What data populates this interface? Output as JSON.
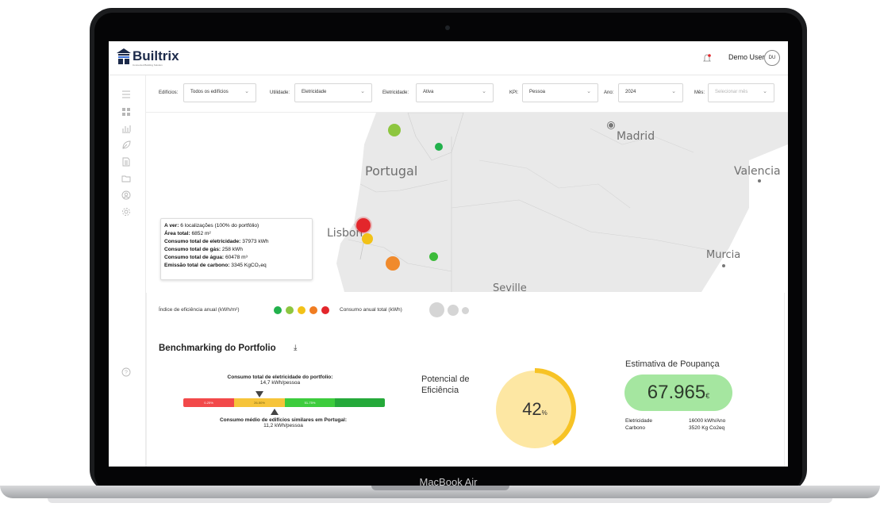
{
  "device": {
    "label": "MacBook Air"
  },
  "header": {
    "logo_text": "Builtrix",
    "logo_subtitle": "Connected Building Solution",
    "user_name": "Demo User",
    "user_initials": "DU"
  },
  "sidebar": {
    "items": [
      "menu-icon",
      "dashboard-icon",
      "chart-icon",
      "leaf-icon",
      "document-icon",
      "folder-icon",
      "user-icon",
      "settings-icon",
      "help-icon"
    ]
  },
  "filters": [
    {
      "label": "Edifícios:",
      "value": "Todos os edifícios",
      "placeholder": false
    },
    {
      "label": "Utilidade:",
      "value": "Eletricidade",
      "placeholder": false
    },
    {
      "label": "Eletricidade:",
      "value": "Ativa",
      "placeholder": false
    },
    {
      "label": "KPI:",
      "value": "Pessoa",
      "placeholder": false
    },
    {
      "label": "Ano:",
      "value": "2024",
      "placeholder": false
    },
    {
      "label": "Mês:",
      "value": "Selecionar mês",
      "placeholder": true
    }
  ],
  "map": {
    "labels": {
      "madrid": "Madrid",
      "portugal": "Portugal",
      "valencia": "Valencia",
      "lisbon": "Lisbon",
      "murcia": "Murcia",
      "seville": "Seville"
    },
    "info": {
      "viewing_label": "A ver:",
      "viewing_value": "6 localizações (100% do portfólio)",
      "area_label": "Área total:",
      "area_value": "6852 m²",
      "elec_label": "Consumo total de eletricidade:",
      "elec_value": "37973 kWh",
      "gas_label": "Consumo total de gás:",
      "gas_value": "258 kWh",
      "water_label": "Consumo total de água:",
      "water_value": "60478 m³",
      "carbon_label": "Emissão total de carbono:",
      "carbon_value": "3345 KgCO₂eq"
    },
    "marker_colors": [
      "#8dc63f",
      "#22b14c",
      "#e3262b",
      "#f2c218",
      "#f08a2c",
      "#3cbb3a"
    ]
  },
  "legend": {
    "efficiency_label": "Índice de eficiência anual (kWh/m²)",
    "efficiency_colors": [
      "#22b14c",
      "#8dc63f",
      "#f2c218",
      "#f07d22",
      "#e3262b"
    ],
    "consumption_label": "Consumo anual total (kWh)"
  },
  "benchmark": {
    "title": "Benchmarking do Portfolio",
    "portfolio_label": "Consumo total de eletricidade do portfolio:",
    "portfolio_value": "14,7 kWh/pessoa",
    "similar_label": "Consumo médio de edifícios similares em Portugal:",
    "similar_value": "11,2 kWh/pessoa",
    "segments": [
      {
        "label": "0-25%",
        "color": "#f2494a"
      },
      {
        "label": "26-50%",
        "color": "#f6c43a"
      },
      {
        "label": "51-75%",
        "color": "#3dcc3d"
      },
      {
        "label": "",
        "color": "#25a93a"
      }
    ]
  },
  "efficiency": {
    "label_line1": "Potencial de",
    "label_line2": "Eficiência",
    "value": "42",
    "unit": "%",
    "fill_fraction": 0.42
  },
  "savings": {
    "title": "Estimativa de Poupança",
    "amount": "67.965",
    "currency": "€",
    "rows": [
      {
        "label": "Eletricidade",
        "value": "16000 kWh/Ano"
      },
      {
        "label": "Carbono",
        "value": "3520 Kg Co2eq"
      }
    ]
  }
}
